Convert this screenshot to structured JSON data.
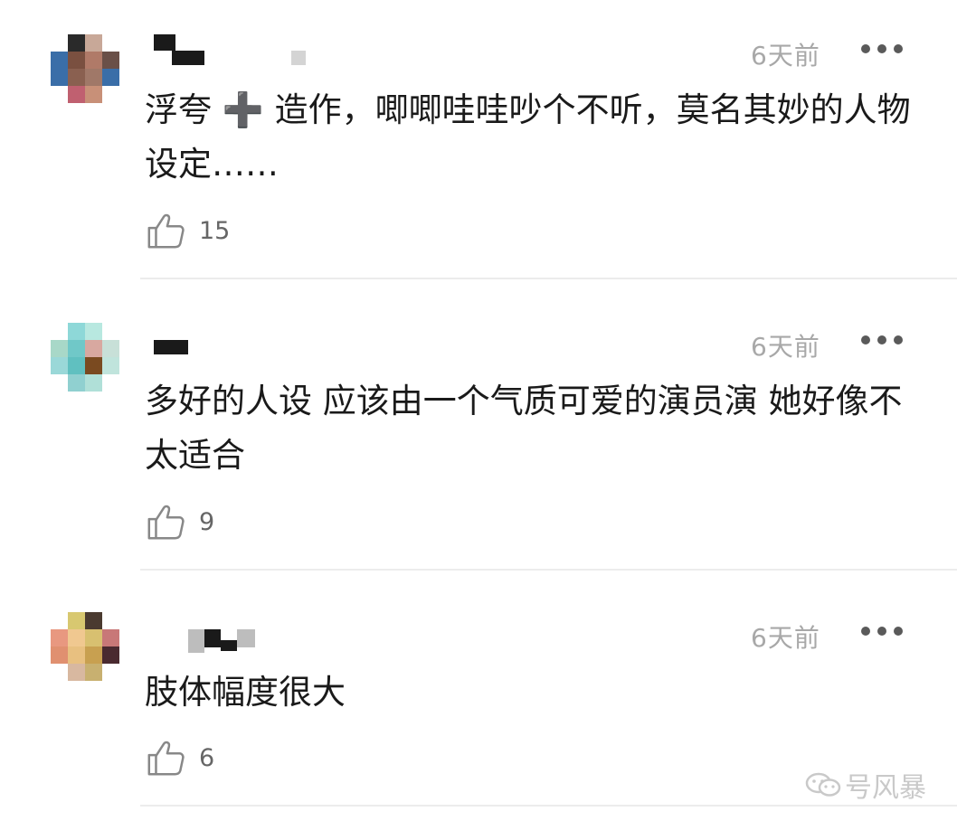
{
  "comments": [
    {
      "time": "6天前",
      "text": "浮夸 ➕ 造作，唧唧哇哇吵个不听，莫名其妙的人物设定……",
      "likes": "15",
      "avatar_colors": [
        "#ffffff",
        "#2a2a2a",
        "#c8a898",
        "#ffffff",
        "#3a6ea8",
        "#7a5040",
        "#b07a68",
        "#6a5048",
        "#3a6ea8",
        "#8a6050",
        "#a07868",
        "#3a6ea8",
        "#ffffff",
        "#c06070",
        "#c89078",
        "#ffffff"
      ]
    },
    {
      "time": "6天前",
      "text": "多好的人设 应该由一个气质可爱的演员演 她好像不太适合",
      "likes": "9",
      "avatar_colors": [
        "#ffffff",
        "#8ed8d8",
        "#b8e8e0",
        "#ffffff",
        "#a8d8c8",
        "#70c8c8",
        "#d8a8a0",
        "#c8e0d8",
        "#9ad8d8",
        "#60c0c0",
        "#7a4a20",
        "#c0e4dc",
        "#ffffff",
        "#90d0d0",
        "#b0e0d8",
        "#ffffff"
      ]
    },
    {
      "time": "6天前",
      "text": "肢体幅度很大",
      "likes": "6",
      "avatar_colors": [
        "#ffffff",
        "#d8c870",
        "#4a3a30",
        "#ffffff",
        "#e89880",
        "#f0c890",
        "#d8c070",
        "#c87878",
        "#e09070",
        "#e8c080",
        "#c8a050",
        "#4a2a30",
        "#ffffff",
        "#d8b8a0",
        "#c8b070",
        "#ffffff"
      ]
    }
  ],
  "watermark": "号风暴",
  "colors": {
    "time": "#a8a8a8",
    "text": "#1a1a1a",
    "count": "#666666",
    "divider": "#ececec"
  },
  "icons": {
    "like": "thumbs-up-icon",
    "more": "more-dots-icon",
    "watermark": "wechat-icon"
  }
}
